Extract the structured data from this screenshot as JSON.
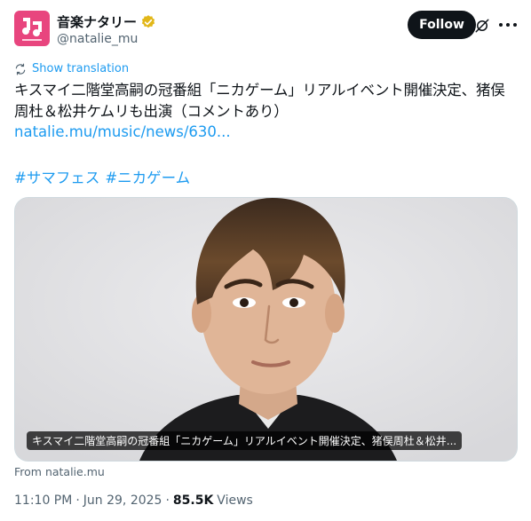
{
  "account": {
    "name": "音楽ナタリー",
    "handle": "@natalie_mu",
    "follow_label": "Follow"
  },
  "tweet": {
    "show_translation": "Show translation",
    "text": "キスマイ二階堂高嗣の冠番組「ニカゲーム」リアルイベント開催決定、猪俣周杜＆松井ケムリも出演（コメントあり）",
    "link": "natalie.mu/music/news/630...",
    "hashtags": [
      "#サマフェス",
      "#ニカゲーム"
    ]
  },
  "card": {
    "caption": "キスマイ二階堂高嗣の冠番組「ニカゲーム」リアルイベント開催決定、猪俣周杜＆松井...",
    "source": "From natalie.mu"
  },
  "meta": {
    "time": "11:10 PM",
    "date": "Jun 29, 2025",
    "views_count": "85.5K",
    "views_label": "Views"
  },
  "colors": {
    "brand_pink": "#e8457e",
    "link_blue": "#1d9bf0",
    "verified_gold": "#e2b719",
    "text": "#0f1419",
    "muted": "#536471"
  },
  "icons": [
    "natalie-logo-icon",
    "verified-badge-icon",
    "grok-icon",
    "more-icon",
    "translate-icon"
  ]
}
